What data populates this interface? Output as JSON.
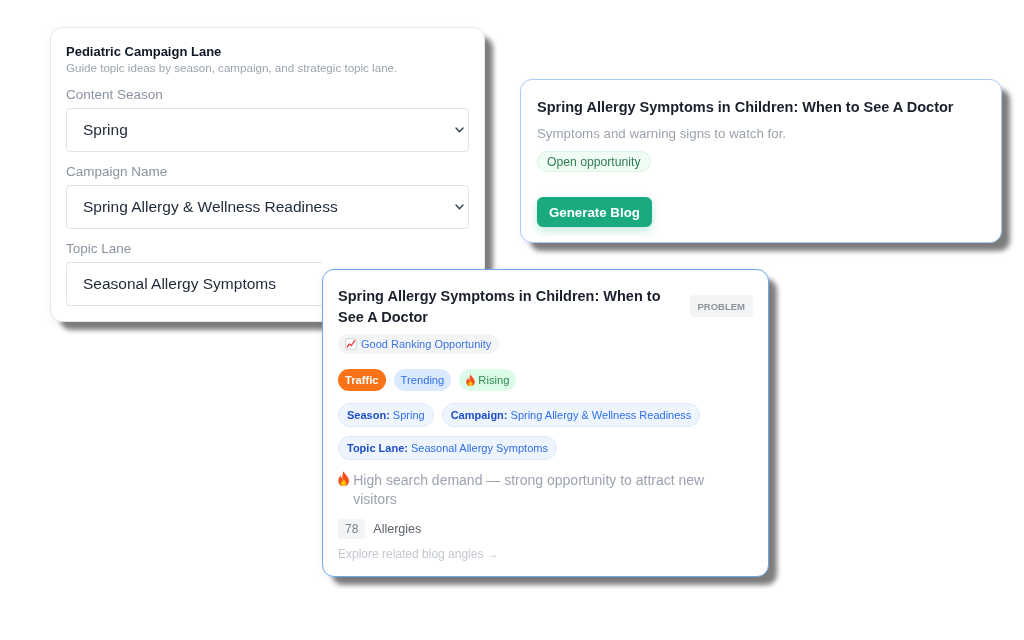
{
  "campaign_panel": {
    "title": "Pediatric Campaign Lane",
    "subtitle": "Guide topic ideas by season, campaign, and strategic topic lane.",
    "fields": [
      {
        "label": "Content Season",
        "kind": "select",
        "value": "Spring"
      },
      {
        "label": "Campaign Name",
        "kind": "select",
        "value": "Spring Allergy & Wellness Readiness"
      },
      {
        "label": "Topic Lane",
        "kind": "text",
        "value": "Seasonal Allergy Symptoms"
      }
    ]
  },
  "topic_card": {
    "title": "Spring Allergy Symptoms in Children: When to See A Doctor",
    "description": "Symptoms and warning signs to watch for.",
    "status": "Open opportunity",
    "button": "Generate Blog"
  },
  "topic_detail_card": {
    "title": "Spring Allergy Symptoms in Children: When to See A Doctor",
    "type": "PROBLEM",
    "ranking": "Good Ranking Opportunity",
    "tags": [
      {
        "label": "Traffic",
        "kind": "traffic"
      },
      {
        "label": "Trending",
        "kind": "trending"
      },
      {
        "label": "Rising",
        "kind": "rising"
      }
    ],
    "attributes": [
      "**Season:** Spring",
      "**Campaign:** Spring Allergy & Wellness Readiness",
      "**Topic Lane:** Seasonal Allergy Symptoms"
    ],
    "insight": "High search demand — strong opportunity to attract new visitors",
    "keyword": {
      "count": "78",
      "name": "Allergies"
    },
    "link": "Explore related blog angles →"
  }
}
